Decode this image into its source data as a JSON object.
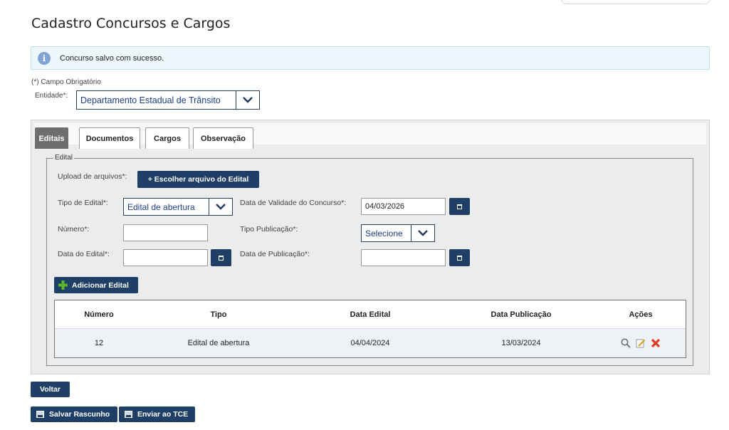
{
  "page": {
    "title": "Cadastro Concursos e Cargos",
    "alert": {
      "icon": "info-icon",
      "message": "Concurso salvo com sucesso."
    },
    "required_note": "(*) Campo Obrigatório"
  },
  "entidade": {
    "label": "Entidade*:",
    "value": "Departamento Estadual de Trânsito"
  },
  "tabs": [
    {
      "label": "Editais",
      "active": true
    },
    {
      "label": "Documentos",
      "active": false
    },
    {
      "label": "Cargos",
      "active": false
    },
    {
      "label": "Observação",
      "active": false
    }
  ],
  "edital": {
    "legend": "Edital",
    "upload_label": "Upload de arquivos*:",
    "upload_button": "+ Escolher arquivo do Edital",
    "tipo_label": "Tipo de Edital*:",
    "tipo_value": "Edital de abertura",
    "validade_label": "Data de Validade do Concurso*:",
    "validade_value": "04/03/2026",
    "numero_label": "Número*:",
    "numero_value": "",
    "tipo_publicacao_label": "Tipo Publicação*:",
    "tipo_publicacao_value": "Selecione",
    "data_edital_label": "Data do Edital*:",
    "data_edital_value": "",
    "data_publicacao_label": "Data de Publicação*:",
    "data_publicacao_value": "",
    "add_button": "Adicionar Edital"
  },
  "table": {
    "headers": [
      "Número",
      "Tipo",
      "Data Edital",
      "Data Publicação",
      "Ações"
    ],
    "rows": [
      {
        "numero": "12",
        "tipo": "Edital de abertura",
        "data_edital": "04/04/2024",
        "data_publicacao": "13/03/2024"
      }
    ]
  },
  "buttons": {
    "voltar": "Voltar",
    "salvar_rascunho": "Salvar Rascunho",
    "enviar_tce": "Enviar ao TCE"
  },
  "colors": {
    "primary_button": "#1f3f66",
    "alert_bg": "#eef7fb",
    "alert_border": "#bfe0ee",
    "add_icon_green": "#5cb82a",
    "delete_red": "#e03b24"
  }
}
